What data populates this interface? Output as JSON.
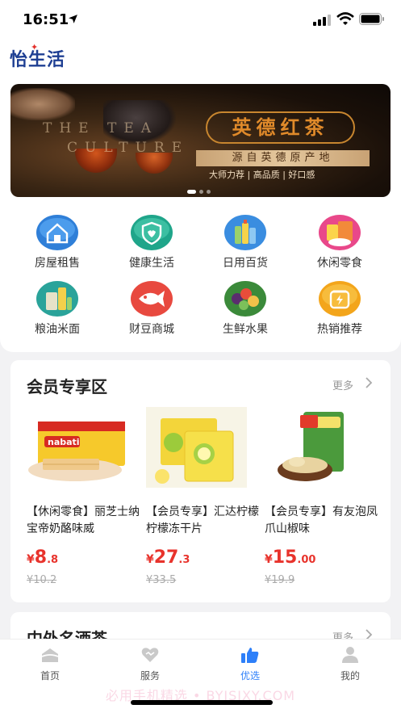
{
  "status": {
    "time": "16:51"
  },
  "app": {
    "logo": "怡生活"
  },
  "banner": {
    "en_line1": "THE TEA",
    "en_line2": "CULTURE",
    "title": "英德红茶",
    "subtitle": "源自英德原产地",
    "tags": "大师力荐 | 高品质 | 好口感"
  },
  "categories": [
    {
      "label": "房屋租售",
      "icon": "house-icon",
      "color": "#2f7fd8"
    },
    {
      "label": "健康生活",
      "icon": "health-shield-icon",
      "color": "#1fa58a"
    },
    {
      "label": "日用百货",
      "icon": "daily-goods-icon",
      "color": "#3a8de0"
    },
    {
      "label": "休闲零食",
      "icon": "snacks-icon",
      "color": "#e9488a"
    },
    {
      "label": "粮油米面",
      "icon": "grain-oil-icon",
      "color": "#2aa39a"
    },
    {
      "label": "财豆商城",
      "icon": "fish-mall-icon",
      "color": "#e8493f"
    },
    {
      "label": "生鲜水果",
      "icon": "fruit-icon",
      "color": "#3b8a3a"
    },
    {
      "label": "热销推荐",
      "icon": "hot-sale-icon",
      "color": "#f3a51b"
    }
  ],
  "member_section": {
    "title": "会员专享区",
    "more": "更多",
    "products": [
      {
        "name": "【休闲零食】丽芝士纳宝帝奶酪味威",
        "price_symbol": "¥",
        "price_int": "8",
        "price_dec": ".8",
        "old_price": "¥10.2"
      },
      {
        "name": "【会员专享】汇达柠檬柠檬冻干片",
        "price_symbol": "¥",
        "price_int": "27",
        "price_dec": ".3",
        "old_price": "¥33.5"
      },
      {
        "name": "【会员专享】有友泡凤爪山椒味",
        "price_symbol": "¥",
        "price_int": "15",
        "price_dec": ".00",
        "old_price": "¥19.9"
      }
    ]
  },
  "next_section": {
    "title": "中外名酒茶",
    "more": "更多"
  },
  "tabbar": [
    {
      "label": "首页",
      "icon": "home-icon"
    },
    {
      "label": "服务",
      "icon": "heart-icon"
    },
    {
      "label": "优选",
      "icon": "thumbs-up-icon"
    },
    {
      "label": "我的",
      "icon": "user-icon"
    }
  ],
  "watermark": "必用手机精选 • BYJSJXY.COM"
}
